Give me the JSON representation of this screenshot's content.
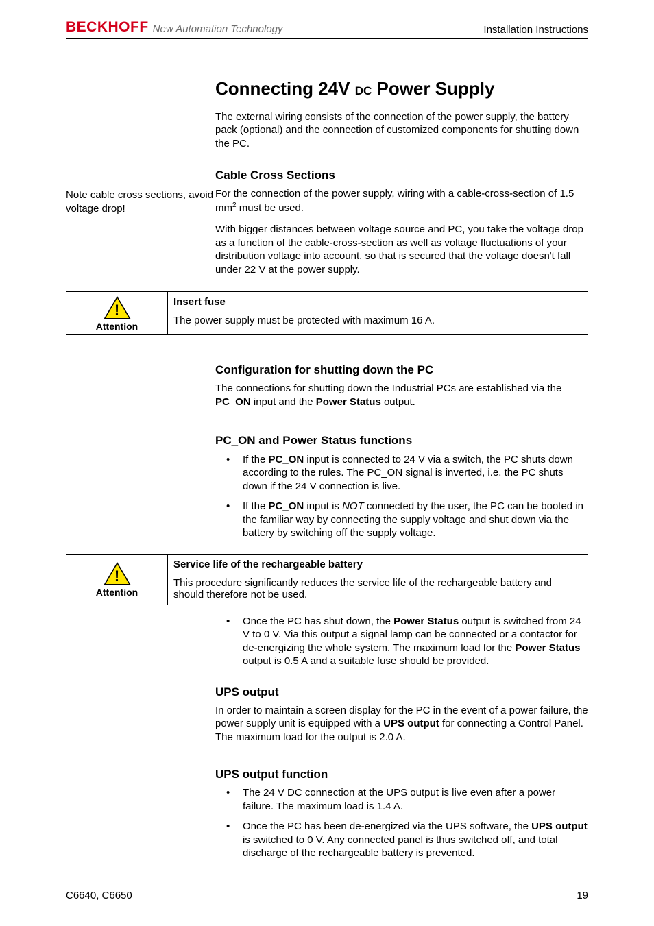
{
  "header": {
    "logo_brand": "BECKHOFF",
    "logo_tagline": "New Automation Technology",
    "right": "Installation Instructions"
  },
  "title": {
    "pre": "Connecting 24V ",
    "sub": "DC",
    "post": " Power Supply"
  },
  "intro": "The external wiring consists of the connection of the power supply, the battery pack (optional) and the connection of customized components for shutting down the PC.",
  "section_cable": {
    "heading": "Cable Cross Sections",
    "sidenote": "Note cable cross sections, avoid voltage drop!",
    "p1_a": "For the connection of the power supply, wiring  with a cable-cross-section of 1.5 mm",
    "p1_sup": "2",
    "p1_b": "  must be used.",
    "p2": "With bigger distances between voltage source and PC, you take the voltage drop as a function of the cable-cross-section as well as voltage fluctuations of your distribution voltage into account, so that is secured that the voltage doesn't fall under 22 V at the power supply."
  },
  "attention1": {
    "label": "Attention",
    "title": "Insert fuse",
    "body": "The power supply must be protected with maximum 16 A."
  },
  "section_config": {
    "heading": "Configuration for shutting down the PC",
    "p1_a": "The connections for shutting down the Industrial PCs are established via the ",
    "p1_b": "PC_ON",
    "p1_c": " input and the ",
    "p1_d": "Power Status",
    "p1_e": " output."
  },
  "section_pc_on": {
    "heading": "PC_ON and Power Status functions",
    "li1_a": "If the ",
    "li1_b": "PC_ON",
    "li1_c": " input is connected to 24 V via a switch, the PC shuts down according to the rules. The PC_ON signal is inverted, i.e. the PC shuts down if the 24 V connection is live.",
    "li2_a": "If the ",
    "li2_b": "PC_ON",
    "li2_c": " input is ",
    "li2_d": "NOT",
    "li2_e": " connected by the user, the PC can be booted in the familiar way by connecting the supply voltage and shut down via the battery by switching off the supply voltage."
  },
  "attention2": {
    "label": "Attention",
    "title": "Service life of the rechargeable battery",
    "body": "This procedure significantly reduces the service life of the rechargeable battery and should therefore not be used."
  },
  "after_attention2": {
    "li_a": "Once the PC has shut down, the ",
    "li_b": "Power Status",
    "li_c": " output is switched from 24 V to 0 V. Via this output a signal lamp can be connected or a contactor for de-energizing the whole system. The maximum load for the ",
    "li_d": "Power Status",
    "li_e": " output is 0.5 A and a suitable fuse should be provided."
  },
  "section_ups": {
    "heading": "UPS output",
    "p_a": "In order to maintain a screen display for the PC in the event of a power failure, the power supply unit is equipped with a ",
    "p_b": "UPS output",
    "p_c": " for connecting a Control Panel. The maximum load for the output is 2.0 A."
  },
  "section_ups_fn": {
    "heading": "UPS output function",
    "li1": "The 24 V DC connection at the UPS output is live even after a power failure. The maximum load is 1.4 A.",
    "li2_a": "Once the PC has been de-energized via the UPS software, the ",
    "li2_b": "UPS output",
    "li2_c": " is switched to 0 V. Any connected panel is thus switched off, and total discharge of the rechargeable battery is prevented."
  },
  "footer": {
    "left": "C6640, C6650",
    "right": "19"
  }
}
